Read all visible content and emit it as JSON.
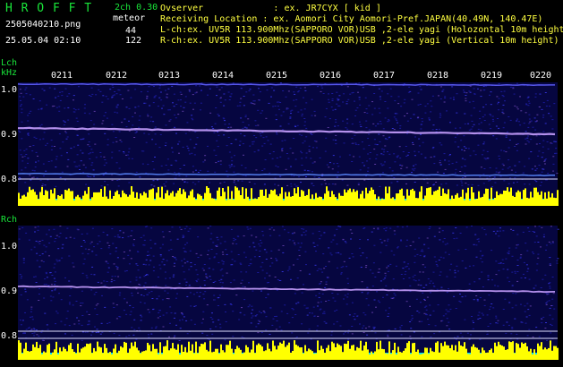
{
  "header": {
    "logo": "H R O F F T",
    "mode": "2ch 0.30",
    "meteor_label": "meteor",
    "filename": "2505040210.png",
    "datetime": "25.05.04 02:10",
    "lch_count": "44",
    "rch_count": "122",
    "observer": "Ovserver             : ex. JR7CYX [ kid ]",
    "location": "Receiving Location : ex. Aomori City Aomori-Pref.JAPAN(40.49N, 140.47E)",
    "lch_info": "L-ch:ex. UV5R 113.900Mhz(SAPPORO VOR)USB ,2-ele yagi (Holozontal 10m height",
    "rch_info": "R-ch:ex. UV5R 113.900Mhz(SAPPORO VOR)USB ,2-ele yagi (Vertical 10m height)"
  },
  "lch": {
    "label": "Lch",
    "unit": "kHz",
    "ticks_y": [
      "1.0",
      "0.9",
      "0.8"
    ]
  },
  "rch": {
    "label": "Rch",
    "ticks_y": [
      "1.0",
      "0.9",
      "0.8"
    ]
  },
  "time_ticks": [
    "0211",
    "0212",
    "0213",
    "0214",
    "0215",
    "0216",
    "0217",
    "0218",
    "0219",
    "0220"
  ],
  "colors": {
    "background": "#000000",
    "text_green": "#19e63a",
    "text_white": "#ffffff",
    "text_yellow": "#ffff40",
    "spectrum_base": "#0a0a5a",
    "signal_line": "#c8a0ff",
    "level_yellow": "#ffff00",
    "level_cyan": "#00ffff"
  }
}
